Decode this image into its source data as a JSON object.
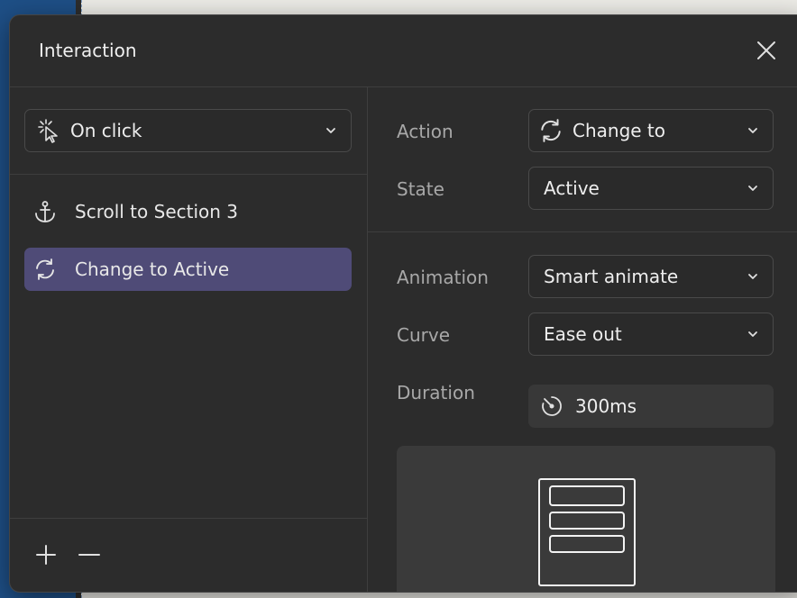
{
  "window": {
    "title": "Interaction"
  },
  "trigger": {
    "label": "On click",
    "icon": "tap-cursor-icon"
  },
  "actions_list": [
    {
      "label": "Scroll to Section 3",
      "icon": "anchor-icon",
      "selected": false
    },
    {
      "label": "Change to Active",
      "icon": "refresh-icon",
      "selected": true
    }
  ],
  "fields": {
    "action": {
      "label": "Action",
      "value": "Change to",
      "icon": "refresh-icon"
    },
    "state": {
      "label": "State",
      "value": "Active"
    },
    "animation": {
      "label": "Animation",
      "value": "Smart animate"
    },
    "curve": {
      "label": "Curve",
      "value": "Ease out"
    },
    "duration": {
      "label": "Duration",
      "value": "300ms",
      "icon": "stopwatch-icon"
    }
  },
  "colors": {
    "dialog_bg": "#2c2c2c",
    "selected_item": "#4f4b77",
    "label_text": "#a8a8a8"
  }
}
